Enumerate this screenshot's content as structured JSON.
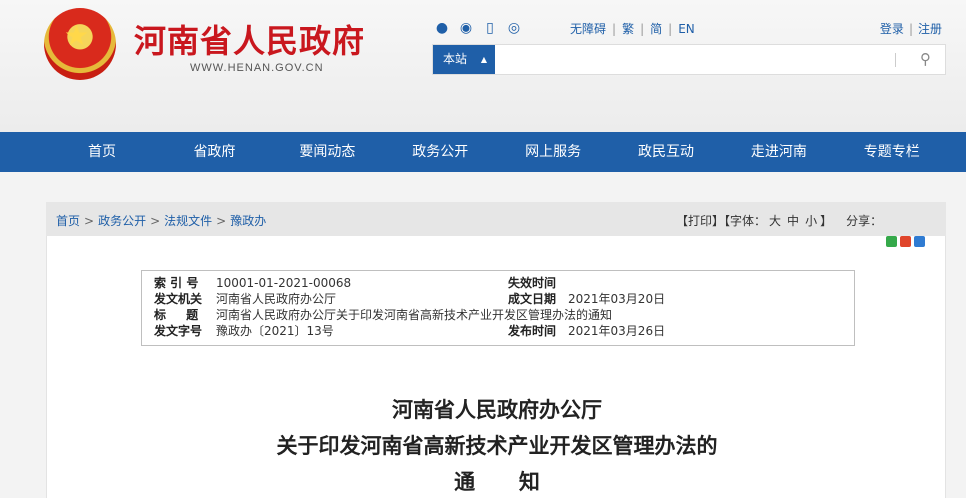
{
  "header": {
    "site_title": "河南省人民政府",
    "site_url": "WWW.HENAN.GOV.CN",
    "social_icons": [
      "wechat-icon",
      "weibo-icon",
      "mobile-icon",
      "app-icon"
    ],
    "tools": [
      "无障碍",
      "繁",
      "简",
      "EN"
    ],
    "login": "登录",
    "register": "注册",
    "search": {
      "scope": "本站",
      "placeholder": ""
    }
  },
  "nav": [
    "首页",
    "省政府",
    "要闻动态",
    "政务公开",
    "网上服务",
    "政民互动",
    "走进河南",
    "专题专栏"
  ],
  "breadcrumb": [
    "首页",
    "政务公开",
    "法规文件",
    "豫政办"
  ],
  "page_tools": {
    "print": "【打印】",
    "font_prefix": "【字体：",
    "sizes": [
      "大",
      "中",
      "小"
    ],
    "font_suffix": "】",
    "share": "分享："
  },
  "meta": {
    "index_label": "索 引 号",
    "index_value": "10001-01-2021-00068",
    "expire_label": "失效时间",
    "expire_value": "",
    "issuer_label": "发文机关",
    "issuer_value": "河南省人民政府办公厅",
    "created_label": "成文日期",
    "created_value": "2021年03月20日",
    "title_label": "标 题",
    "title_value": "河南省人民政府办公厅关于印发河南省高新技术产业开发区管理办法的通知",
    "docno_label": "发文字号",
    "docno_value": "豫政办〔2021〕13号",
    "published_label": "发布时间",
    "published_value": "2021年03月26日"
  },
  "document": {
    "title_line1": "河南省人民政府办公厅",
    "title_line2": "关于印发河南省高新技术产业开发区管理办法的",
    "title_line3": "通      知"
  },
  "colors": {
    "brand_red": "#c9171e",
    "nav_blue": "#1f5fa8"
  }
}
